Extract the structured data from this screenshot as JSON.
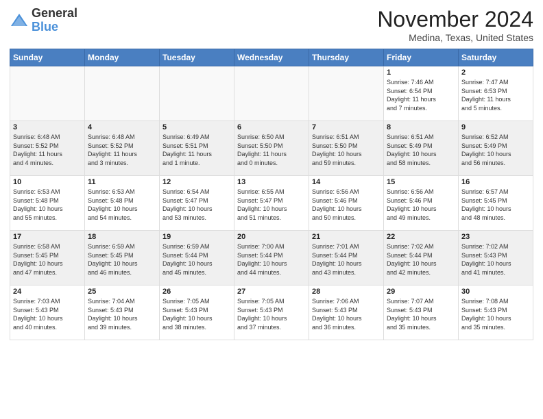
{
  "header": {
    "logo_line1": "General",
    "logo_line2": "Blue",
    "month": "November 2024",
    "location": "Medina, Texas, United States"
  },
  "weekdays": [
    "Sunday",
    "Monday",
    "Tuesday",
    "Wednesday",
    "Thursday",
    "Friday",
    "Saturday"
  ],
  "weeks": [
    [
      {
        "day": "",
        "info": ""
      },
      {
        "day": "",
        "info": ""
      },
      {
        "day": "",
        "info": ""
      },
      {
        "day": "",
        "info": ""
      },
      {
        "day": "",
        "info": ""
      },
      {
        "day": "1",
        "info": "Sunrise: 7:46 AM\nSunset: 6:54 PM\nDaylight: 11 hours\nand 7 minutes."
      },
      {
        "day": "2",
        "info": "Sunrise: 7:47 AM\nSunset: 6:53 PM\nDaylight: 11 hours\nand 5 minutes."
      }
    ],
    [
      {
        "day": "3",
        "info": "Sunrise: 6:48 AM\nSunset: 5:52 PM\nDaylight: 11 hours\nand 4 minutes."
      },
      {
        "day": "4",
        "info": "Sunrise: 6:48 AM\nSunset: 5:52 PM\nDaylight: 11 hours\nand 3 minutes."
      },
      {
        "day": "5",
        "info": "Sunrise: 6:49 AM\nSunset: 5:51 PM\nDaylight: 11 hours\nand 1 minute."
      },
      {
        "day": "6",
        "info": "Sunrise: 6:50 AM\nSunset: 5:50 PM\nDaylight: 11 hours\nand 0 minutes."
      },
      {
        "day": "7",
        "info": "Sunrise: 6:51 AM\nSunset: 5:50 PM\nDaylight: 10 hours\nand 59 minutes."
      },
      {
        "day": "8",
        "info": "Sunrise: 6:51 AM\nSunset: 5:49 PM\nDaylight: 10 hours\nand 58 minutes."
      },
      {
        "day": "9",
        "info": "Sunrise: 6:52 AM\nSunset: 5:49 PM\nDaylight: 10 hours\nand 56 minutes."
      }
    ],
    [
      {
        "day": "10",
        "info": "Sunrise: 6:53 AM\nSunset: 5:48 PM\nDaylight: 10 hours\nand 55 minutes."
      },
      {
        "day": "11",
        "info": "Sunrise: 6:53 AM\nSunset: 5:48 PM\nDaylight: 10 hours\nand 54 minutes."
      },
      {
        "day": "12",
        "info": "Sunrise: 6:54 AM\nSunset: 5:47 PM\nDaylight: 10 hours\nand 53 minutes."
      },
      {
        "day": "13",
        "info": "Sunrise: 6:55 AM\nSunset: 5:47 PM\nDaylight: 10 hours\nand 51 minutes."
      },
      {
        "day": "14",
        "info": "Sunrise: 6:56 AM\nSunset: 5:46 PM\nDaylight: 10 hours\nand 50 minutes."
      },
      {
        "day": "15",
        "info": "Sunrise: 6:56 AM\nSunset: 5:46 PM\nDaylight: 10 hours\nand 49 minutes."
      },
      {
        "day": "16",
        "info": "Sunrise: 6:57 AM\nSunset: 5:45 PM\nDaylight: 10 hours\nand 48 minutes."
      }
    ],
    [
      {
        "day": "17",
        "info": "Sunrise: 6:58 AM\nSunset: 5:45 PM\nDaylight: 10 hours\nand 47 minutes."
      },
      {
        "day": "18",
        "info": "Sunrise: 6:59 AM\nSunset: 5:45 PM\nDaylight: 10 hours\nand 46 minutes."
      },
      {
        "day": "19",
        "info": "Sunrise: 6:59 AM\nSunset: 5:44 PM\nDaylight: 10 hours\nand 45 minutes."
      },
      {
        "day": "20",
        "info": "Sunrise: 7:00 AM\nSunset: 5:44 PM\nDaylight: 10 hours\nand 44 minutes."
      },
      {
        "day": "21",
        "info": "Sunrise: 7:01 AM\nSunset: 5:44 PM\nDaylight: 10 hours\nand 43 minutes."
      },
      {
        "day": "22",
        "info": "Sunrise: 7:02 AM\nSunset: 5:44 PM\nDaylight: 10 hours\nand 42 minutes."
      },
      {
        "day": "23",
        "info": "Sunrise: 7:02 AM\nSunset: 5:43 PM\nDaylight: 10 hours\nand 41 minutes."
      }
    ],
    [
      {
        "day": "24",
        "info": "Sunrise: 7:03 AM\nSunset: 5:43 PM\nDaylight: 10 hours\nand 40 minutes."
      },
      {
        "day": "25",
        "info": "Sunrise: 7:04 AM\nSunset: 5:43 PM\nDaylight: 10 hours\nand 39 minutes."
      },
      {
        "day": "26",
        "info": "Sunrise: 7:05 AM\nSunset: 5:43 PM\nDaylight: 10 hours\nand 38 minutes."
      },
      {
        "day": "27",
        "info": "Sunrise: 7:05 AM\nSunset: 5:43 PM\nDaylight: 10 hours\nand 37 minutes."
      },
      {
        "day": "28",
        "info": "Sunrise: 7:06 AM\nSunset: 5:43 PM\nDaylight: 10 hours\nand 36 minutes."
      },
      {
        "day": "29",
        "info": "Sunrise: 7:07 AM\nSunset: 5:43 PM\nDaylight: 10 hours\nand 35 minutes."
      },
      {
        "day": "30",
        "info": "Sunrise: 7:08 AM\nSunset: 5:43 PM\nDaylight: 10 hours\nand 35 minutes."
      }
    ]
  ]
}
